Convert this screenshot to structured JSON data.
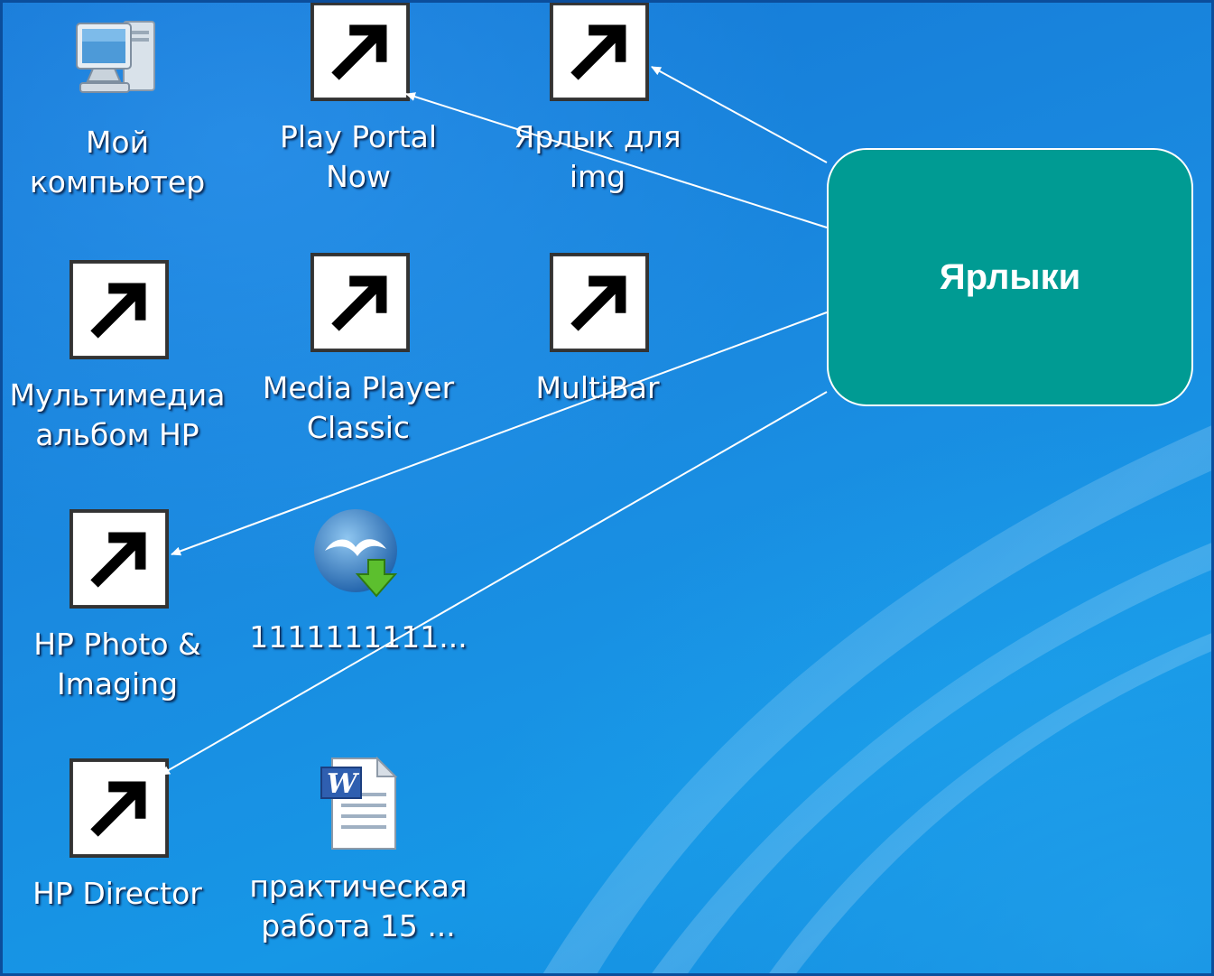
{
  "desktop": {
    "icons": [
      {
        "id": "my-computer",
        "label": "Мой\nкомпьютер",
        "shortcut": false,
        "icon": "computer-icon"
      },
      {
        "id": "play-portal-now",
        "label": "Play Portal\nNow",
        "shortcut": true,
        "icon": "play-portal-icon"
      },
      {
        "id": "img-shortcut",
        "label": "Ярлык для img",
        "shortcut": true,
        "icon": "image-file-icon"
      },
      {
        "id": "hp-multimedia-album",
        "label": "Мультимедиа\nальбом HP",
        "shortcut": true,
        "icon": "multimedia-album-icon"
      },
      {
        "id": "media-player-classic",
        "label": "Media Player\nClassic",
        "shortcut": true,
        "icon": "clapperboard-icon"
      },
      {
        "id": "multibar",
        "label": "MultiBar",
        "shortcut": true,
        "icon": "multibar-icon"
      },
      {
        "id": "hp-photo-imaging",
        "label": "HP Photo &\nImaging",
        "shortcut": true,
        "icon": "photo-imaging-icon"
      },
      {
        "id": "openoffice-download",
        "label": "1111111111...",
        "shortcut": false,
        "icon": "openoffice-download-icon"
      },
      {
        "id": "hp-director",
        "label": "HP Director",
        "shortcut": true,
        "icon": "hp-director-icon"
      },
      {
        "id": "word-practical",
        "label": "практическая\nработа 15 ...",
        "shortcut": false,
        "icon": "word-document-icon"
      }
    ]
  },
  "callout": {
    "text": "Ярлыки",
    "color": "#009b93",
    "border_color": "#ffffff"
  },
  "colors": {
    "desktop_blue": "#1a8ae0",
    "label_text": "#ffffff",
    "pointer_line": "#ffffff"
  }
}
